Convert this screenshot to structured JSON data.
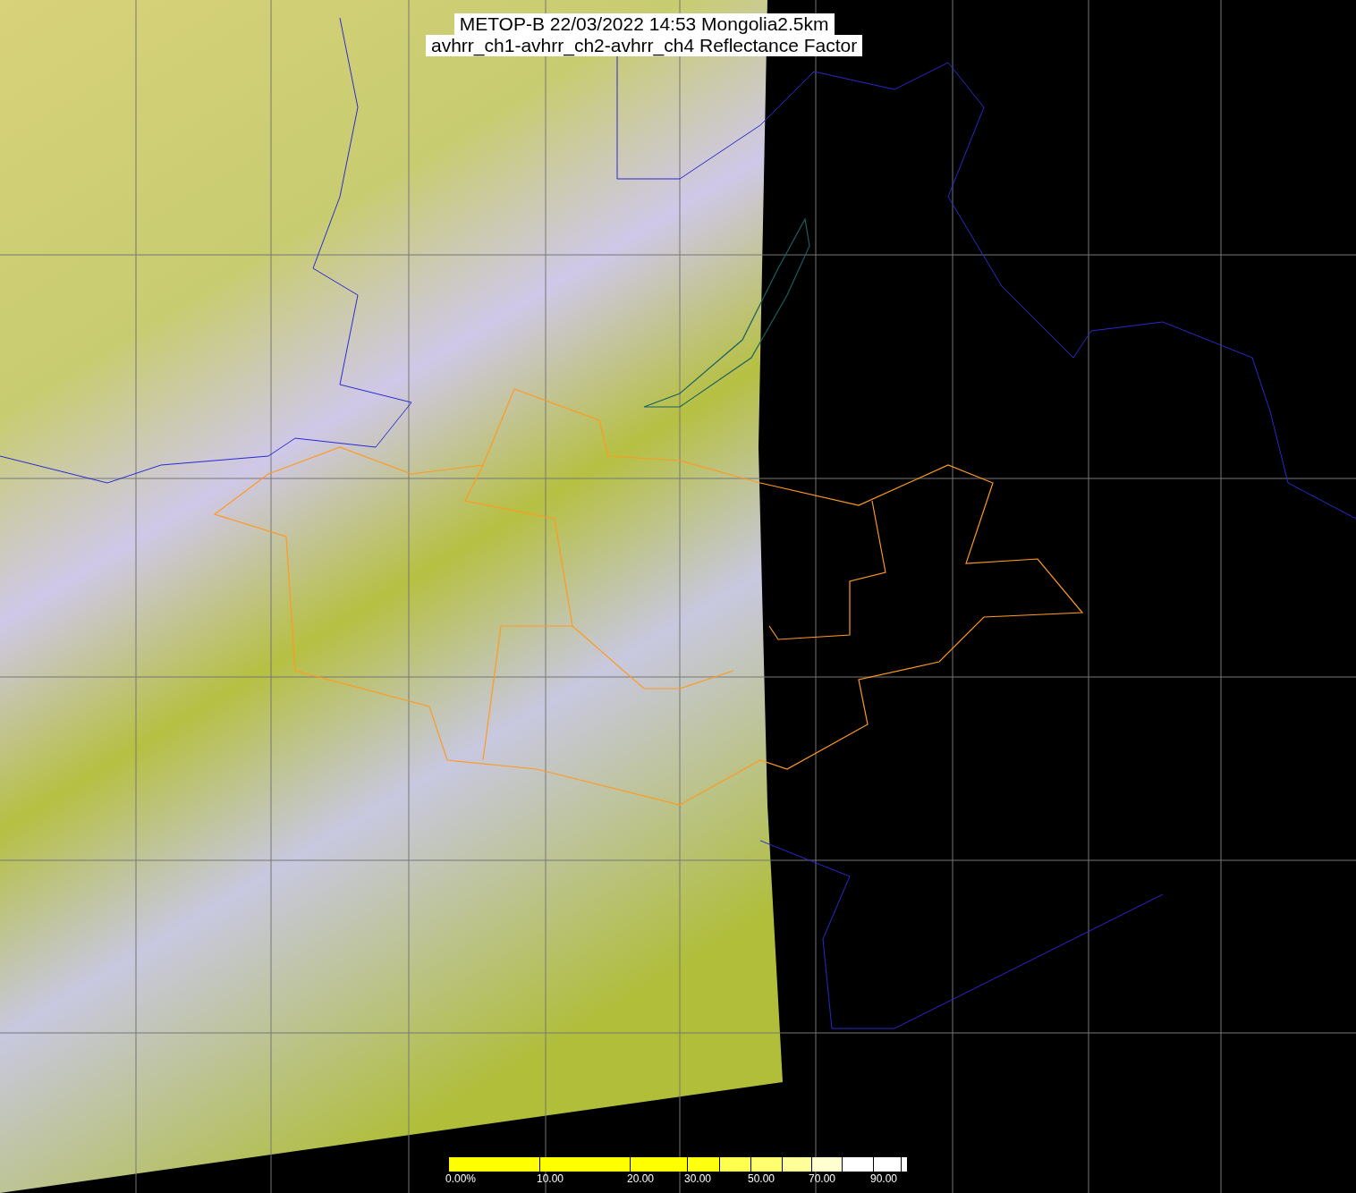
{
  "title": {
    "lines": [
      "METOP-B 22/03/2022 14:53 Mongolia2.5km",
      "avhrr_ch1-avhrr_ch2-avhrr_ch4 Reflectance Factor"
    ]
  },
  "colorbar": {
    "segments": [
      {
        "label": "0.00%",
        "color": "#ffff00"
      },
      {
        "label": "10.00",
        "color": "#ffff00"
      },
      {
        "label": "20.00",
        "color": "#ffff00"
      },
      {
        "label": "30.00",
        "color": "#ffff10"
      },
      {
        "color": "#ffff50"
      },
      {
        "label": "50.00",
        "color": "#ffff70"
      },
      {
        "color": "#ffff99"
      },
      {
        "label": "70.00",
        "color": "#ffffd0"
      },
      {
        "color": "#ffffff"
      },
      {
        "label": "90.00",
        "color": "#ffffff"
      }
    ]
  }
}
